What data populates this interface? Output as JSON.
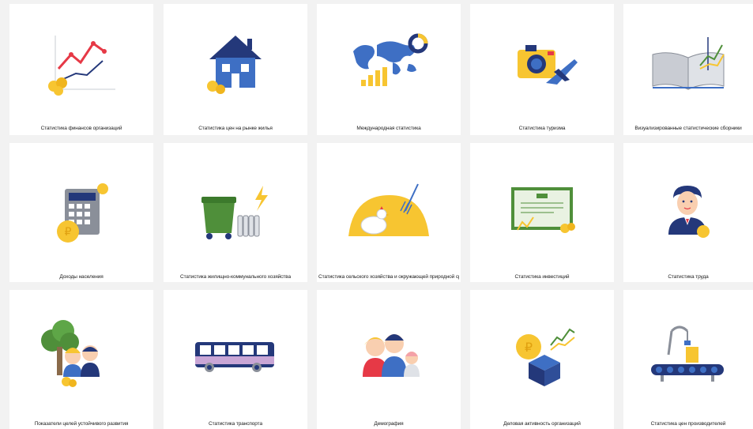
{
  "colors": {
    "blue": "#3e6fc4",
    "navy": "#24387a",
    "yellow": "#f7c531",
    "red": "#e63946",
    "green": "#4f8f3a",
    "gray": "#8a8f99",
    "pink": "#f4a1a8"
  },
  "tiles": [
    {
      "label": "Статистика финансов организаций",
      "icon": "finance-chart-icon"
    },
    {
      "label": "Статистика цен на рынке жилья",
      "icon": "house-icon"
    },
    {
      "label": "Международная статистика",
      "icon": "world-map-icon"
    },
    {
      "label": "Статистика туризма",
      "icon": "camera-plane-icon"
    },
    {
      "label": "Визуализированные статистические сборники",
      "icon": "open-book-chart-icon"
    },
    {
      "label": "Доходы населения",
      "icon": "calculator-coin-icon"
    },
    {
      "label": "Статистика жилищно-коммунального хозяйства",
      "icon": "dumpster-radiator-icon"
    },
    {
      "label": "Статистика сельского хозяйства и окружающей природной среды",
      "icon": "haystack-hen-icon"
    },
    {
      "label": "Статистика инвестиций",
      "icon": "certificate-icon"
    },
    {
      "label": "Статистика труда",
      "icon": "worker-icon"
    },
    {
      "label": "Показатели целей устойчивого развития",
      "icon": "tree-family-icon"
    },
    {
      "label": "Статистика транспорта",
      "icon": "bus-icon"
    },
    {
      "label": "Демография",
      "icon": "family-icon"
    },
    {
      "label": "Деловая активность организаций",
      "icon": "coin-box-chart-icon"
    },
    {
      "label": "Статистика цен производителей",
      "icon": "conveyor-icon"
    }
  ]
}
